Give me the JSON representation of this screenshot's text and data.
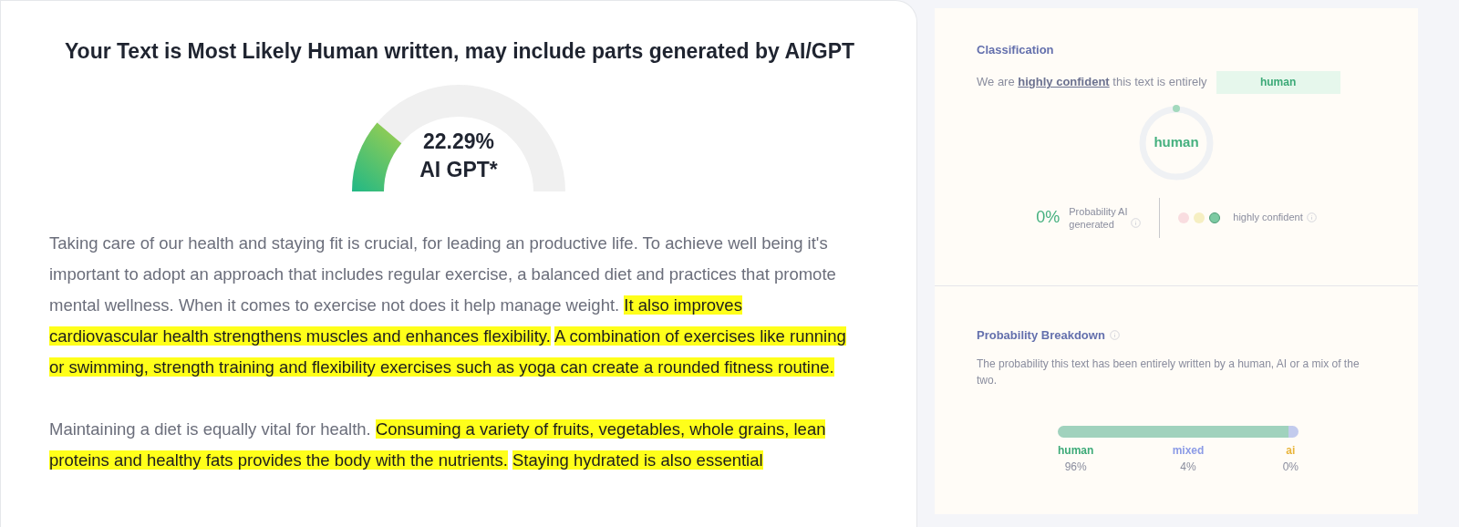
{
  "result": {
    "title": "Your Text is Most Likely Human written, may include parts generated by AI/GPT",
    "gauge": {
      "percent": "22.29%",
      "label": "AI GPT*"
    },
    "paragraphs": [
      {
        "segments": [
          {
            "text": "Taking care of our health and staying fit is crucial, for leading an productive life. To achieve well being it's important to adopt an approach that includes regular exercise, a balanced diet and practices that promote mental wellness. When it comes to exercise not does it help manage weight.",
            "highlighted": false
          },
          {
            "text": "It also improves cardiovascular health strengthens muscles and enhances flexibility.",
            "highlighted": true
          },
          {
            "text": "A combination of exercises like running or swimming, strength training and flexibility exercises such as yoga can create a rounded fitness routine.",
            "highlighted": true
          }
        ]
      },
      {
        "segments": [
          {
            "text": "Maintaining a diet is equally vital for health.",
            "highlighted": false
          },
          {
            "text": "Consuming a variety of fruits, vegetables, whole grains, lean proteins and healthy fats provides the body with the nutrients.",
            "highlighted": true
          },
          {
            "text": "Staying hydrated is also essential",
            "highlighted": true
          }
        ]
      }
    ]
  },
  "classification": {
    "heading": "Classification",
    "statement": "We are **highly confident** this text is entirely",
    "verdict": "human",
    "ring_label": "human",
    "probability": "0%",
    "probability_label": "Probability AI generated",
    "confidence_dots": [
      {
        "color": "#f9dde0",
        "selected": false
      },
      {
        "color": "#f6efc2",
        "selected": false
      },
      {
        "color": "#7ccaa2",
        "selected": true
      }
    ],
    "confidence_label": "highly confident"
  },
  "breakdown": {
    "heading": "Probability Breakdown",
    "description": "The probability this text has been entirely written by a human, AI or a mix of the two.",
    "segments": [
      {
        "label": "human",
        "value": "96%",
        "color": "#3daa78"
      },
      {
        "label": "mixed",
        "value": "4%",
        "color": "#8c9be6"
      },
      {
        "label": "ai",
        "value": "0%",
        "color": "#e9b43a"
      }
    ]
  }
}
